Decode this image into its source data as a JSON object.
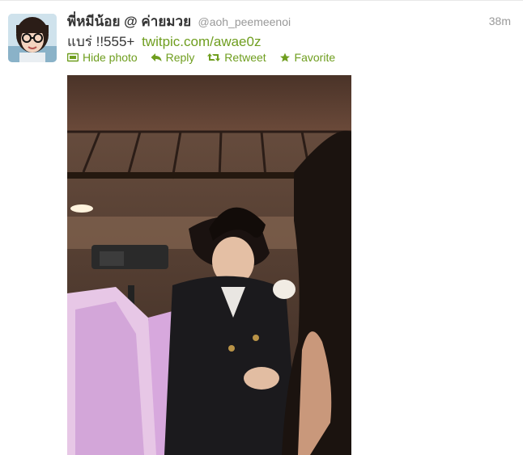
{
  "tweet": {
    "fullname": "พี่หมีน้อย @ ค่ายมวย",
    "username": "@aoh_peemeenoi",
    "timestamp": "38m",
    "text": "แบร่ !!555+",
    "link": "twitpic.com/awae0z",
    "actions": {
      "hide_photo": "Hide photo",
      "reply": "Reply",
      "retweet": "Retweet",
      "favorite": "Favorite"
    }
  },
  "icons": {
    "hide_photo": "photo-icon",
    "reply": "reply-arrow-icon",
    "retweet": "retweet-arrows-icon",
    "favorite": "star-icon"
  },
  "colors": {
    "link": "#6f9e1f",
    "muted": "#999999",
    "text": "#333333"
  }
}
